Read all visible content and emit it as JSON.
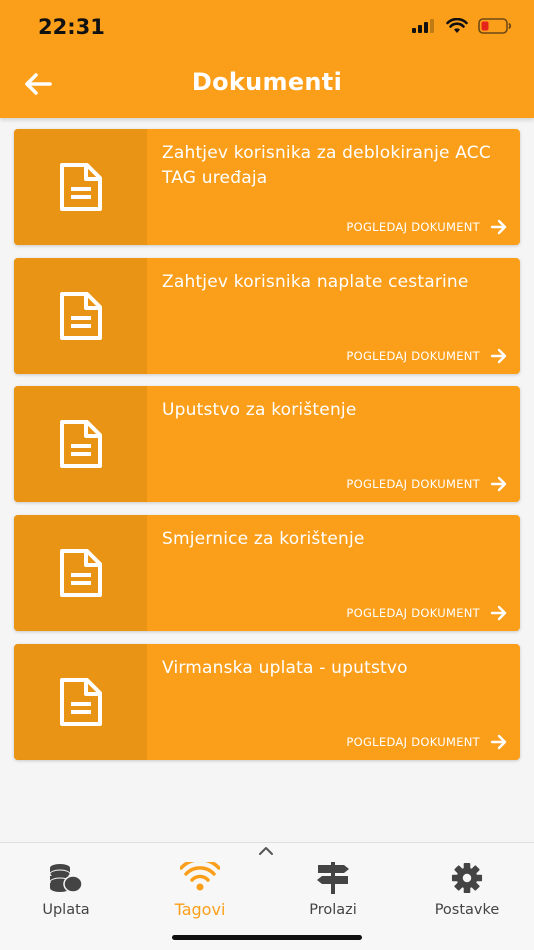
{
  "status_bar": {
    "time": "22:31"
  },
  "header": {
    "title": "Dokumenti"
  },
  "documents": [
    {
      "title": "Zahtjev korisnika za deblokiranje ACC TAG uređaja",
      "action": "POGLEDAJ DOKUMENT"
    },
    {
      "title": "Zahtjev korisnika naplate cestarine",
      "action": "POGLEDAJ DOKUMENT"
    },
    {
      "title": "Uputstvo za korištenje",
      "action": "POGLEDAJ DOKUMENT"
    },
    {
      "title": "Smjernice za korištenje",
      "action": "POGLEDAJ DOKUMENT"
    },
    {
      "title": "Virmanska uplata - uputstvo",
      "action": "POGLEDAJ DOKUMENT"
    }
  ],
  "tabs": [
    {
      "label": "Uplata",
      "icon": "coins-icon",
      "active": false
    },
    {
      "label": "Tagovi",
      "icon": "wifi-icon",
      "active": true
    },
    {
      "label": "Prolazi",
      "icon": "signpost-icon",
      "active": false
    },
    {
      "label": "Postavke",
      "icon": "gear-icon",
      "active": false
    }
  ],
  "colors": {
    "accent": "#fb9f1b",
    "accent_dark": "#e99414",
    "text_light": "#ffffff"
  }
}
